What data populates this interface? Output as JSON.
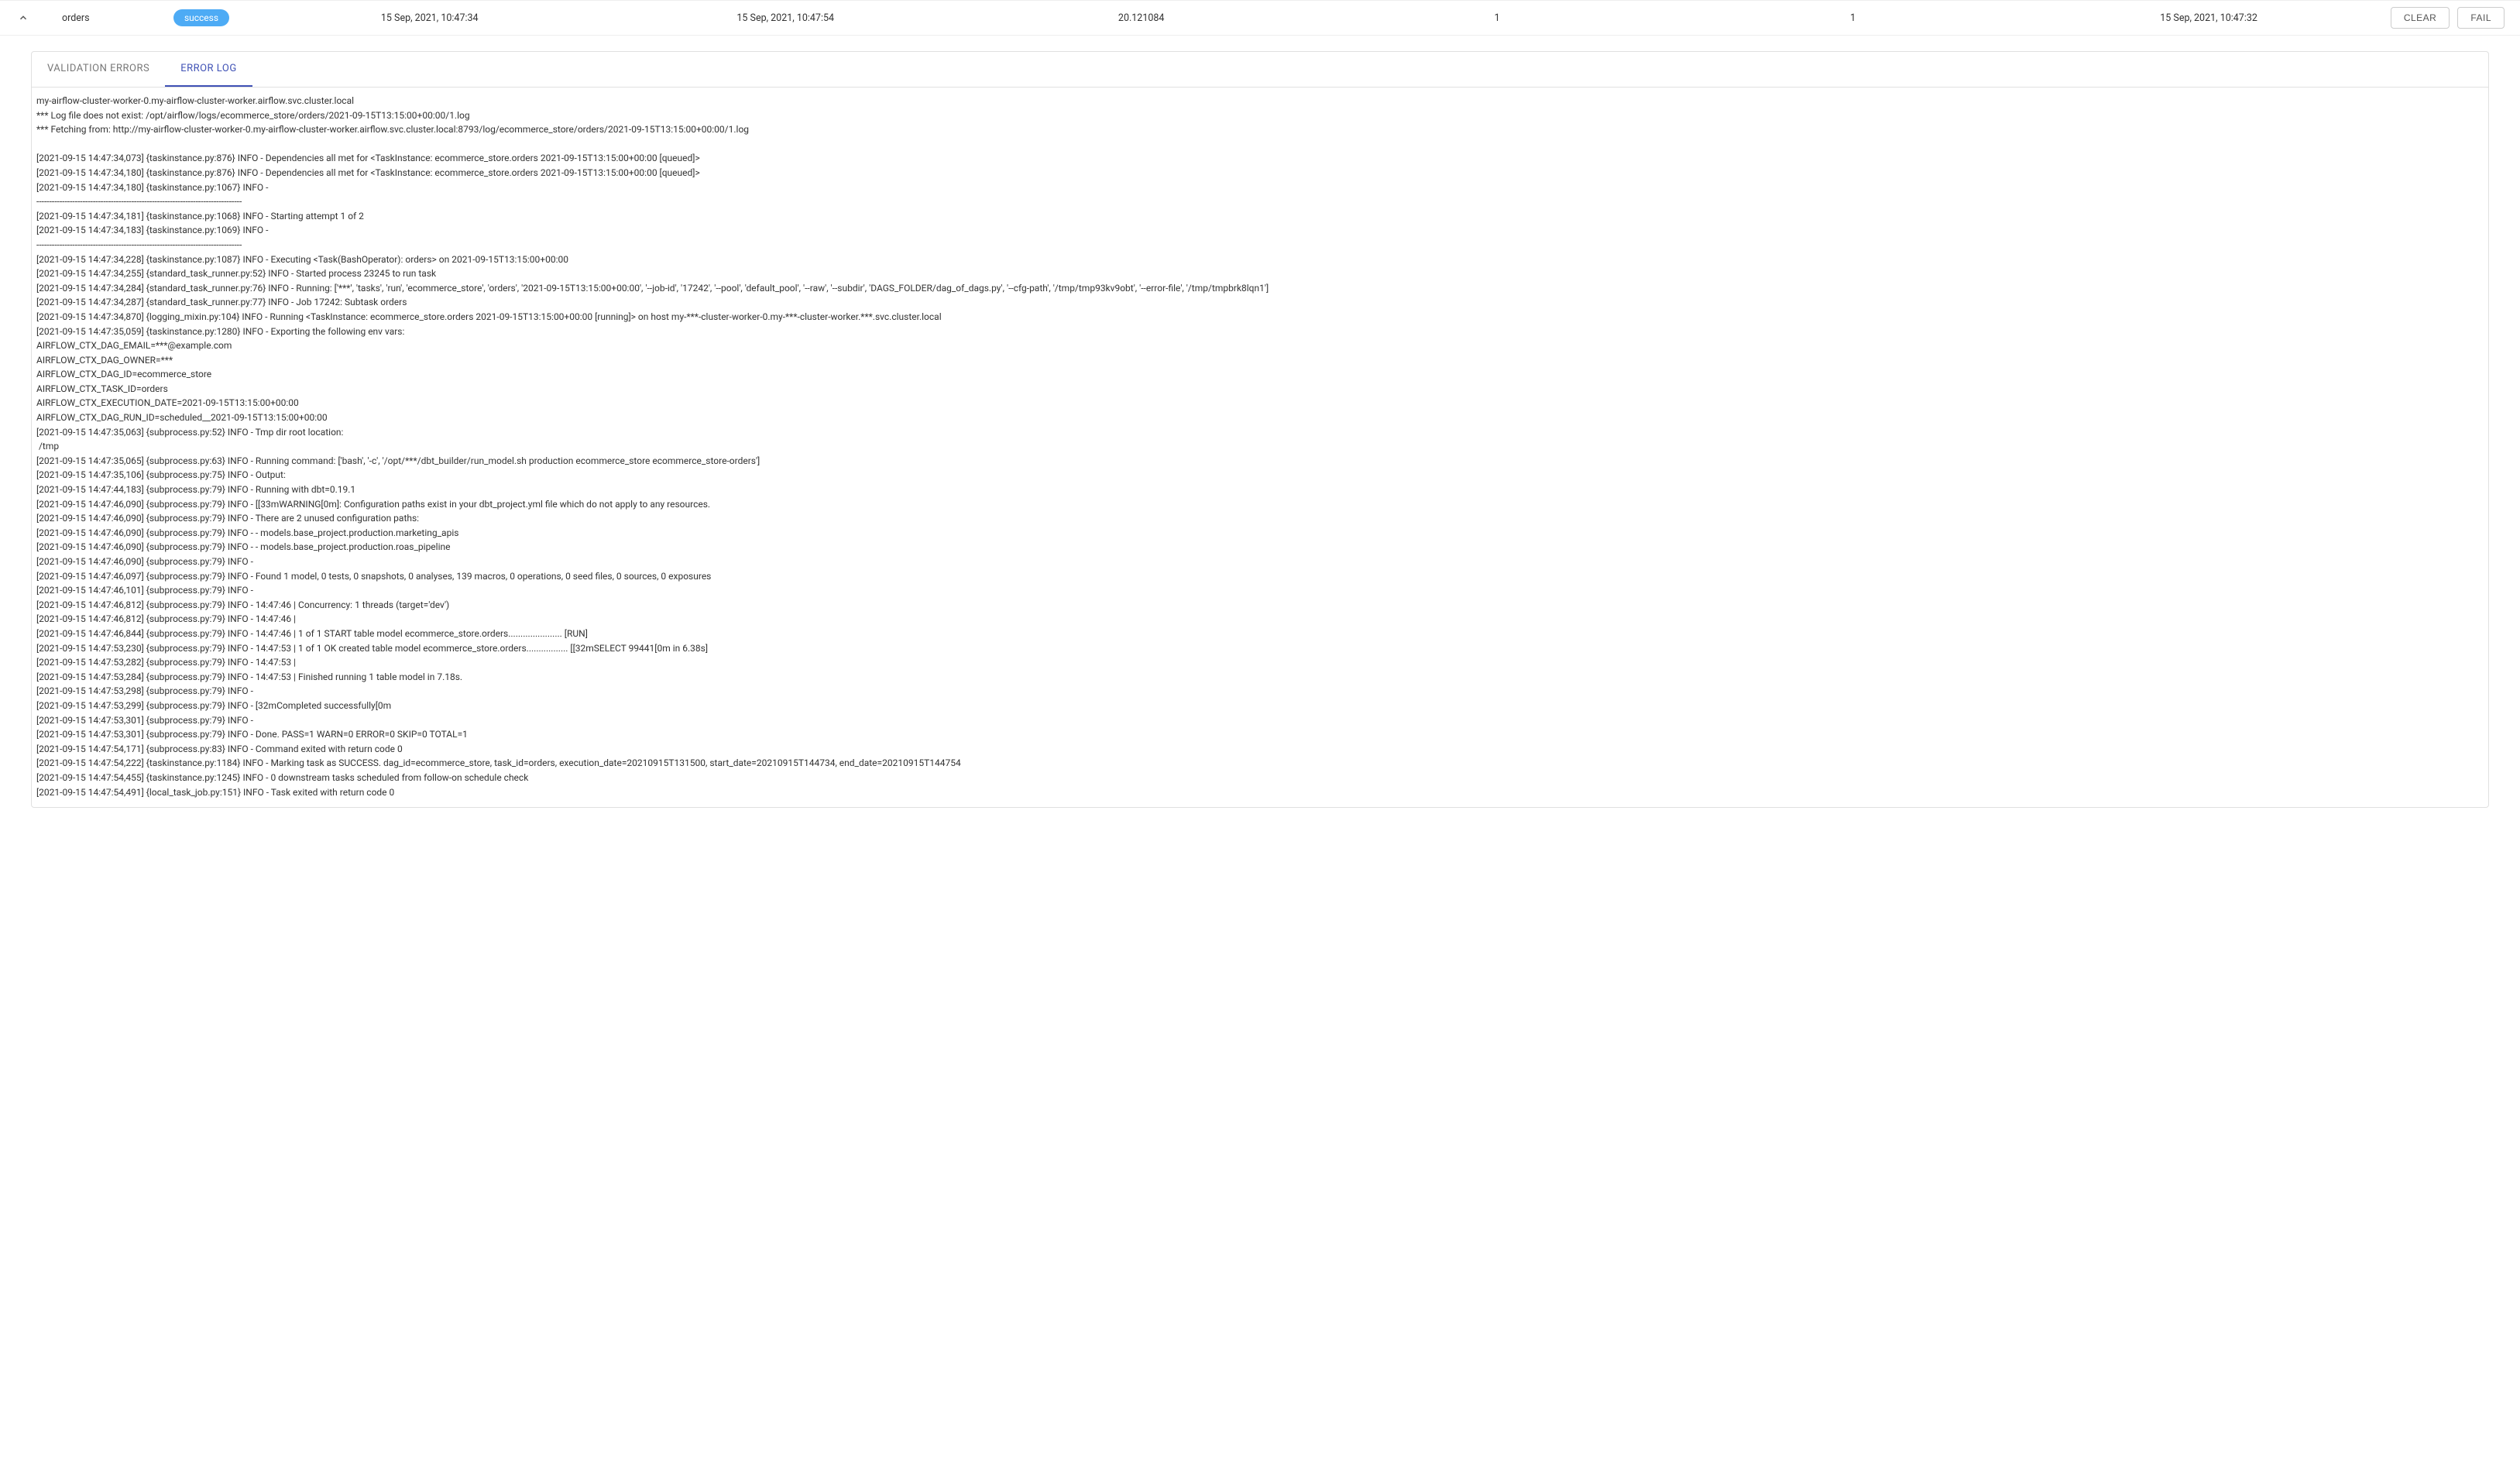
{
  "header": {
    "task_name": "orders",
    "status": "success",
    "start_time": "15 Sep, 2021, 10:47:34",
    "end_time": "15 Sep, 2021, 10:47:54",
    "duration": "20.121084",
    "attempt": "1",
    "retries": "1",
    "scheduled": "15 Sep, 2021, 10:47:32",
    "clear_label": "CLEAR",
    "fail_label": "FAIL"
  },
  "tabs": {
    "validation_errors": "VALIDATION ERRORS",
    "error_log": "ERROR LOG"
  },
  "log": "my-airflow-cluster-worker-0.my-airflow-cluster-worker.airflow.svc.cluster.local\n*** Log file does not exist: /opt/airflow/logs/ecommerce_store/orders/2021-09-15T13:15:00+00:00/1.log\n*** Fetching from: http://my-airflow-cluster-worker-0.my-airflow-cluster-worker.airflow.svc.cluster.local:8793/log/ecommerce_store/orders/2021-09-15T13:15:00+00:00/1.log\n\n[2021-09-15 14:47:34,073] {taskinstance.py:876} INFO - Dependencies all met for <TaskInstance: ecommerce_store.orders 2021-09-15T13:15:00+00:00 [queued]>\n[2021-09-15 14:47:34,180] {taskinstance.py:876} INFO - Dependencies all met for <TaskInstance: ecommerce_store.orders 2021-09-15T13:15:00+00:00 [queued]>\n[2021-09-15 14:47:34,180] {taskinstance.py:1067} INFO - \n--------------------------------------------------------------------------------\n[2021-09-15 14:47:34,181] {taskinstance.py:1068} INFO - Starting attempt 1 of 2\n[2021-09-15 14:47:34,183] {taskinstance.py:1069} INFO - \n--------------------------------------------------------------------------------\n[2021-09-15 14:47:34,228] {taskinstance.py:1087} INFO - Executing <Task(BashOperator): orders> on 2021-09-15T13:15:00+00:00\n[2021-09-15 14:47:34,255] {standard_task_runner.py:52} INFO - Started process 23245 to run task\n[2021-09-15 14:47:34,284] {standard_task_runner.py:76} INFO - Running: ['***', 'tasks', 'run', 'ecommerce_store', 'orders', '2021-09-15T13:15:00+00:00', '--job-id', '17242', '--pool', 'default_pool', '--raw', '--subdir', 'DAGS_FOLDER/dag_of_dags.py', '--cfg-path', '/tmp/tmp93kv9obt', '--error-file', '/tmp/tmpbrk8lqn1']\n[2021-09-15 14:47:34,287] {standard_task_runner.py:77} INFO - Job 17242: Subtask orders\n[2021-09-15 14:47:34,870] {logging_mixin.py:104} INFO - Running <TaskInstance: ecommerce_store.orders 2021-09-15T13:15:00+00:00 [running]> on host my-***-cluster-worker-0.my-***-cluster-worker.***.svc.cluster.local\n[2021-09-15 14:47:35,059] {taskinstance.py:1280} INFO - Exporting the following env vars:\nAIRFLOW_CTX_DAG_EMAIL=***@example.com\nAIRFLOW_CTX_DAG_OWNER=***\nAIRFLOW_CTX_DAG_ID=ecommerce_store\nAIRFLOW_CTX_TASK_ID=orders\nAIRFLOW_CTX_EXECUTION_DATE=2021-09-15T13:15:00+00:00\nAIRFLOW_CTX_DAG_RUN_ID=scheduled__2021-09-15T13:15:00+00:00\n[2021-09-15 14:47:35,063] {subprocess.py:52} INFO - Tmp dir root location: \n /tmp\n[2021-09-15 14:47:35,065] {subprocess.py:63} INFO - Running command: ['bash', '-c', '/opt/***/dbt_builder/run_model.sh production ecommerce_store ecommerce_store-orders']\n[2021-09-15 14:47:35,106] {subprocess.py:75} INFO - Output:\n[2021-09-15 14:47:44,183] {subprocess.py:79} INFO - Running with dbt=0.19.1\n[2021-09-15 14:47:46,090] {subprocess.py:79} INFO - [[33mWARNING[0m]: Configuration paths exist in your dbt_project.yml file which do not apply to any resources.\n[2021-09-15 14:47:46,090] {subprocess.py:79} INFO - There are 2 unused configuration paths:\n[2021-09-15 14:47:46,090] {subprocess.py:79} INFO - - models.base_project.production.marketing_apis\n[2021-09-15 14:47:46,090] {subprocess.py:79} INFO - - models.base_project.production.roas_pipeline\n[2021-09-15 14:47:46,090] {subprocess.py:79} INFO - \n[2021-09-15 14:47:46,097] {subprocess.py:79} INFO - Found 1 model, 0 tests, 0 snapshots, 0 analyses, 139 macros, 0 operations, 0 seed files, 0 sources, 0 exposures\n[2021-09-15 14:47:46,101] {subprocess.py:79} INFO - \n[2021-09-15 14:47:46,812] {subprocess.py:79} INFO - 14:47:46 | Concurrency: 1 threads (target='dev')\n[2021-09-15 14:47:46,812] {subprocess.py:79} INFO - 14:47:46 | \n[2021-09-15 14:47:46,844] {subprocess.py:79} INFO - 14:47:46 | 1 of 1 START table model ecommerce_store.orders...................... [RUN]\n[2021-09-15 14:47:53,230] {subprocess.py:79} INFO - 14:47:53 | 1 of 1 OK created table model ecommerce_store.orders................. [[32mSELECT 99441[0m in 6.38s]\n[2021-09-15 14:47:53,282] {subprocess.py:79} INFO - 14:47:53 | \n[2021-09-15 14:47:53,284] {subprocess.py:79} INFO - 14:47:53 | Finished running 1 table model in 7.18s.\n[2021-09-15 14:47:53,298] {subprocess.py:79} INFO - \n[2021-09-15 14:47:53,299] {subprocess.py:79} INFO - [32mCompleted successfully[0m\n[2021-09-15 14:47:53,301] {subprocess.py:79} INFO - \n[2021-09-15 14:47:53,301] {subprocess.py:79} INFO - Done. PASS=1 WARN=0 ERROR=0 SKIP=0 TOTAL=1\n[2021-09-15 14:47:54,171] {subprocess.py:83} INFO - Command exited with return code 0\n[2021-09-15 14:47:54,222] {taskinstance.py:1184} INFO - Marking task as SUCCESS. dag_id=ecommerce_store, task_id=orders, execution_date=20210915T131500, start_date=20210915T144734, end_date=20210915T144754\n[2021-09-15 14:47:54,455] {taskinstance.py:1245} INFO - 0 downstream tasks scheduled from follow-on schedule check\n[2021-09-15 14:47:54,491] {local_task_job.py:151} INFO - Task exited with return code 0"
}
